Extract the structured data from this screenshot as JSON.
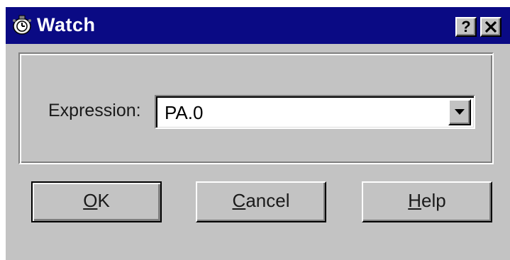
{
  "window": {
    "title": "Watch",
    "title_bar_color": "#0a0a84",
    "face_color": "#c3c3c3",
    "icon": "watch-icon"
  },
  "title_buttons": {
    "help": "?",
    "close": "✕"
  },
  "form": {
    "expression_label": "Expression:",
    "expression_value": "PA.0"
  },
  "buttons": {
    "ok": {
      "mnemonic": "O",
      "rest": "K"
    },
    "cancel": {
      "mnemonic": "C",
      "rest": "ancel"
    },
    "help": {
      "mnemonic": "H",
      "rest": "elp"
    }
  }
}
